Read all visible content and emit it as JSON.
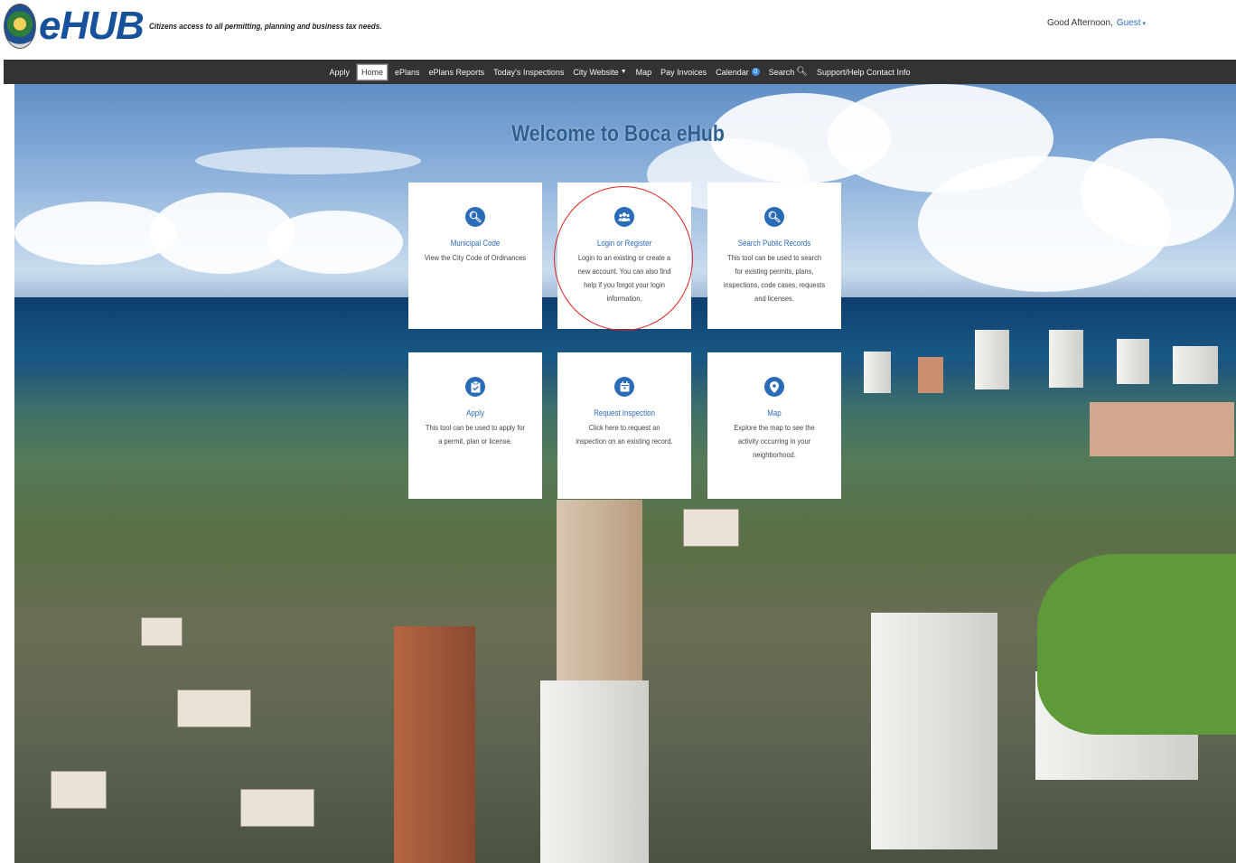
{
  "header": {
    "logo_text": "eHUB",
    "tagline": "Citizens access to all permitting, planning and business tax needs.",
    "greeting": "Good Afternoon,",
    "user": "Guest"
  },
  "nav": {
    "items": [
      {
        "label": "Apply"
      },
      {
        "label": "Home",
        "active": true
      },
      {
        "label": "ePlans"
      },
      {
        "label": "ePlans Reports"
      },
      {
        "label": "Today's Inspections"
      },
      {
        "label": "City Website",
        "dropdown": true
      },
      {
        "label": "Map"
      },
      {
        "label": "Pay Invoices"
      },
      {
        "label": "Calendar",
        "badge": "0"
      },
      {
        "label": "Search",
        "icon": "search-icon"
      },
      {
        "label": "Support/Help Contact Info"
      }
    ]
  },
  "main": {
    "welcome": "Welcome to Boca eHub",
    "cards": [
      {
        "title": "Municipal Code",
        "desc": "View the City Code of Ordinances",
        "icon": "search-icon"
      },
      {
        "title": "Login or Register",
        "desc": "Login to an existing or create a new account. You can also find help if you forgot your login information.",
        "icon": "users-icon"
      },
      {
        "title": "Search Public Records",
        "desc": "This tool can be used to search for existing permits, plans, inspections, code cases, requests and licenses.",
        "icon": "search-icon"
      },
      {
        "title": "Apply",
        "desc": "This tool can be used to apply for a permit, plan or license.",
        "icon": "clipboard-check-icon"
      },
      {
        "title": "Request Inspection",
        "desc": "Click here to request an inspection on an existing record.",
        "icon": "calendar-icon"
      },
      {
        "title": "Map",
        "desc": "Explore the map to see the activity occurring in your neighborhood.",
        "icon": "map-pin-icon"
      }
    ]
  },
  "colors": {
    "accent": "#2a6bb8",
    "navbar": "#333333",
    "annotation": "#dd2222"
  }
}
